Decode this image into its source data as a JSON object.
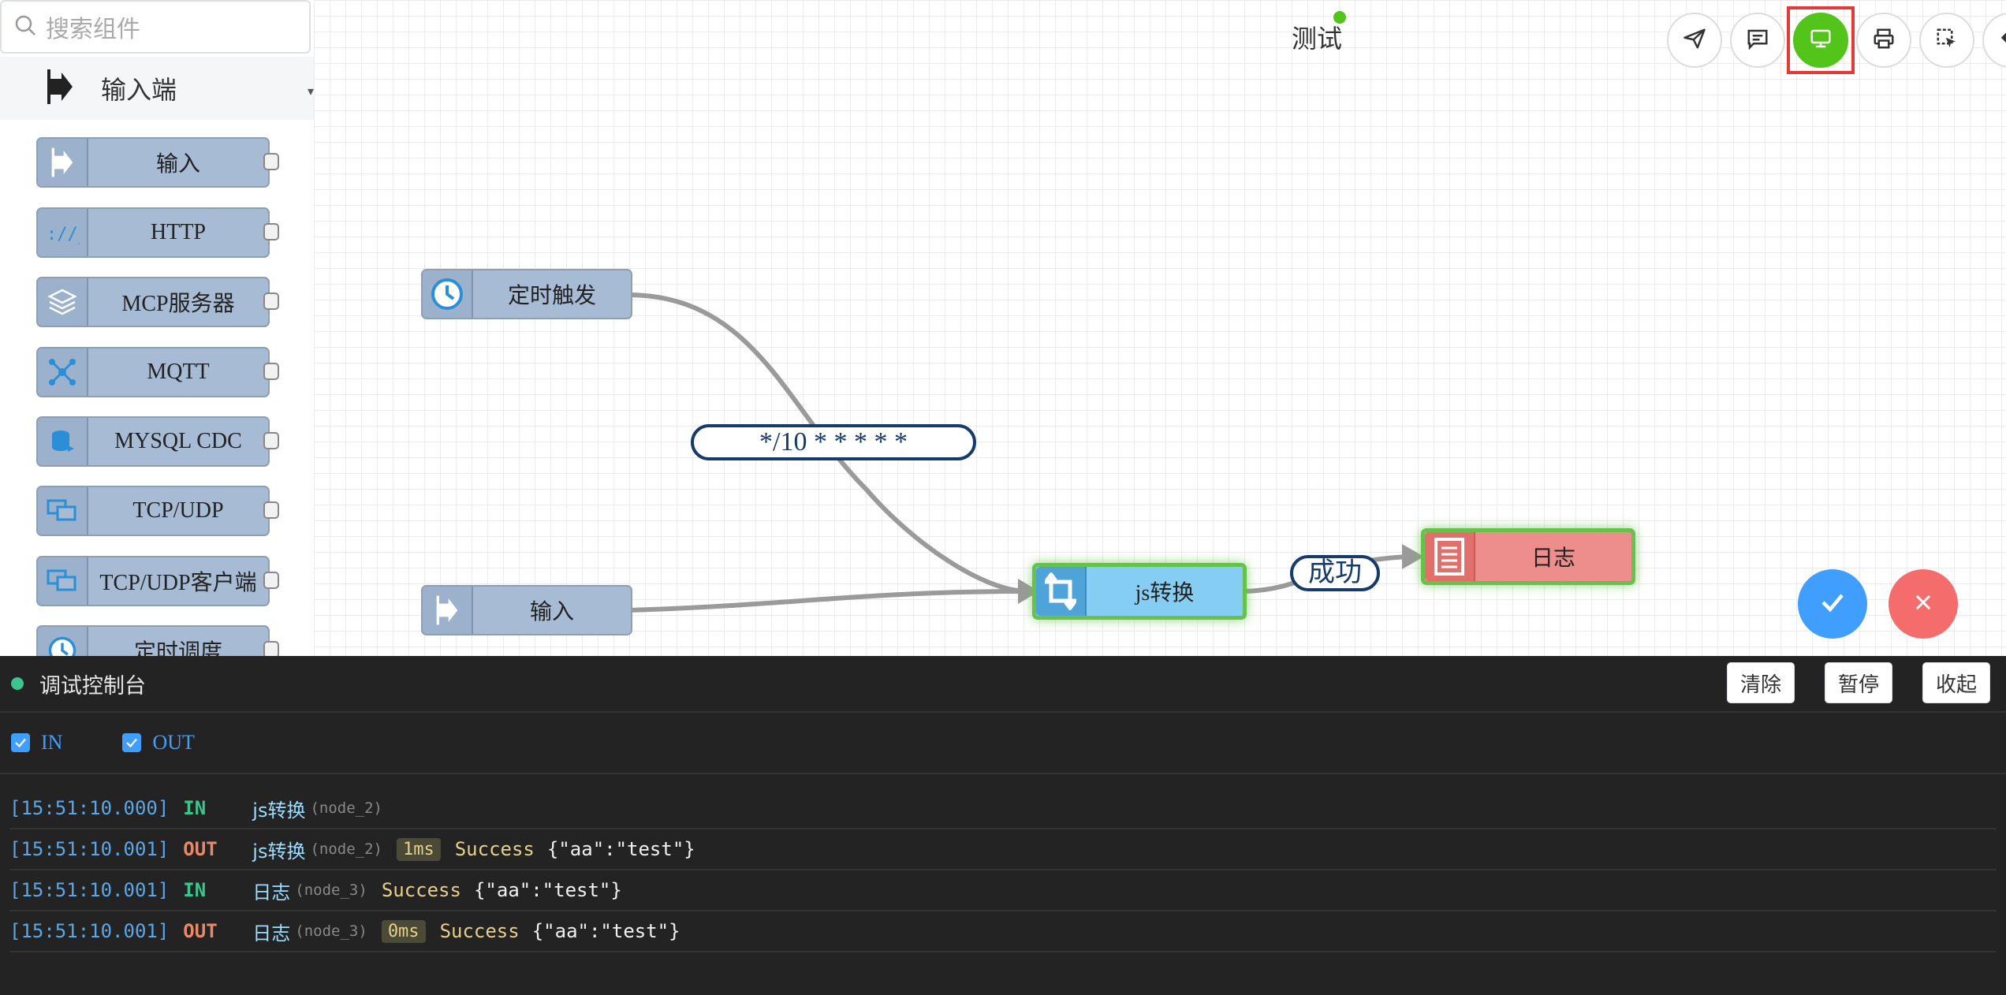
{
  "search": {
    "placeholder": "搜索组件"
  },
  "palette": {
    "group_label": "输入端",
    "items": [
      {
        "label": "输入",
        "icon": "input-arrow-icon"
      },
      {
        "label": "HTTP",
        "icon": "http-icon"
      },
      {
        "label": "MCP服务器",
        "icon": "layers-icon"
      },
      {
        "label": "MQTT",
        "icon": "mqtt-icon"
      },
      {
        "label": "MYSQL CDC",
        "icon": "database-icon"
      },
      {
        "label": "TCP/UDP",
        "icon": "network-icon"
      },
      {
        "label": "TCP/UDP客户端",
        "icon": "network-icon"
      },
      {
        "label": "定时调度",
        "icon": "clock-icon"
      }
    ]
  },
  "canvas": {
    "title": "测试",
    "nodes": {
      "timer": "定时触发",
      "input": "输入",
      "js": "js转换",
      "log": "日志"
    },
    "edge_labels": {
      "cron": "*/10 * * * * *",
      "success": "成功"
    },
    "colors": {
      "accent": "#52c41a",
      "wire": "#9a9a9a",
      "edge_label": "#163a6b",
      "primary": "#409eff",
      "danger": "#f56c6c"
    }
  },
  "toolbar": {
    "icons": [
      "send-icon",
      "comment-icon",
      "monitor-icon",
      "print-icon",
      "select-icon",
      "undo-icon",
      "redo-icon",
      "location-icon",
      "gear-icon",
      "fullscreen-icon"
    ]
  },
  "console": {
    "title": "调试控制台",
    "buttons": {
      "clear": "清除",
      "pause": "暂停",
      "collapse": "收起"
    },
    "filters": {
      "in": "IN",
      "out": "OUT"
    },
    "logs": [
      {
        "time": "[15:51:10.000]",
        "dir": "IN",
        "name": "js转换",
        "id": "(node_2)",
        "ms": "",
        "status": "",
        "payload": ""
      },
      {
        "time": "[15:51:10.001]",
        "dir": "OUT",
        "name": "js转换",
        "id": "(node_2)",
        "ms": "1ms",
        "status": "Success",
        "payload": "{\"aa\":\"test\"}"
      },
      {
        "time": "[15:51:10.001]",
        "dir": "IN",
        "name": "日志",
        "id": "(node_3)",
        "ms": "",
        "status": "Success",
        "payload": "{\"aa\":\"test\"}"
      },
      {
        "time": "[15:51:10.001]",
        "dir": "OUT",
        "name": "日志",
        "id": "(node_3)",
        "ms": "0ms",
        "status": "Success",
        "payload": "{\"aa\":\"test\"}"
      }
    ]
  }
}
